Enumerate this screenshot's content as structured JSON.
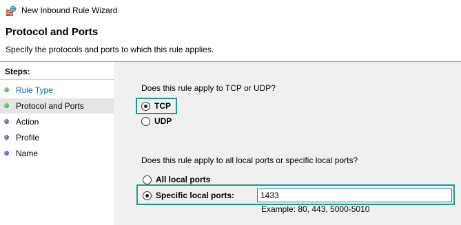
{
  "window": {
    "title": "New Inbound Rule Wizard",
    "icon": "firewall-globe-icon"
  },
  "header": {
    "title": "Protocol and Ports",
    "subtitle": "Specify the protocols and ports to which this rule applies."
  },
  "steps": {
    "heading": "Steps:",
    "items": [
      {
        "label": "Rule Type",
        "state": "done"
      },
      {
        "label": "Protocol and Ports",
        "state": "current"
      },
      {
        "label": "Action",
        "state": "todo"
      },
      {
        "label": "Profile",
        "state": "todo"
      },
      {
        "label": "Name",
        "state": "todo"
      }
    ]
  },
  "protocol": {
    "question": "Does this rule apply to TCP or UDP?",
    "options": [
      {
        "label": "TCP",
        "selected": true
      },
      {
        "label": "UDP",
        "selected": false
      }
    ]
  },
  "ports": {
    "question": "Does this rule apply to all local ports or specific local ports?",
    "options": [
      {
        "label": "All local ports",
        "selected": false
      },
      {
        "label": "Specific local ports:",
        "selected": true
      }
    ],
    "value": "1433",
    "example": "Example: 80, 443, 5000-5010"
  },
  "colors": {
    "highlight": "#1a9e8c",
    "link": "#0b64c0",
    "content_bg": "#f0f0f0"
  }
}
